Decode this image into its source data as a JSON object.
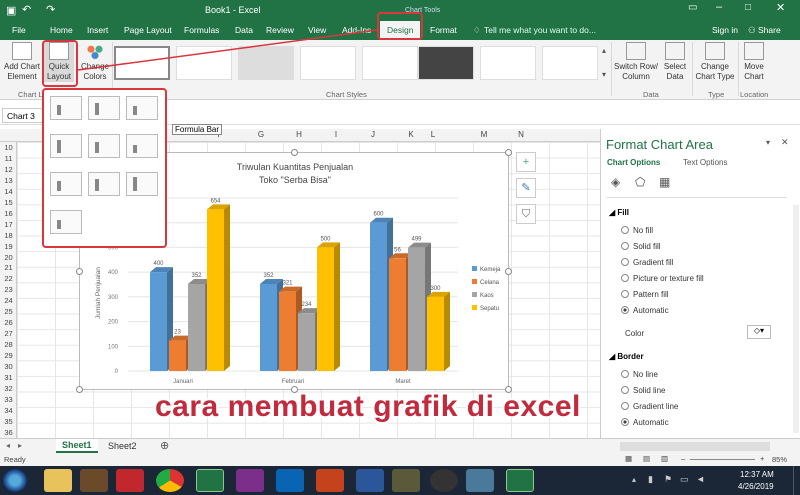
{
  "titlebar": {
    "title": "Book1 - Excel",
    "context": "Chart Tools",
    "signin": "Sign in",
    "share": "Share"
  },
  "tabs": [
    "File",
    "Home",
    "Insert",
    "Page Layout",
    "Formulas",
    "Data",
    "Review",
    "View",
    "Add-Ins",
    "Design",
    "Format"
  ],
  "tellme": "Tell me what you want to do...",
  "ribbon": {
    "add_chart_element": "Add Chart Element",
    "quick_layout": "Quick Layout",
    "change_colors": "Change Colors",
    "switch_row_col": "Switch Row/ Column",
    "select_data": "Select Data",
    "change_chart_type": "Change Chart Type",
    "move_chart": "Move Chart",
    "groups": {
      "layouts": "Chart La",
      "styles": "Chart Styles",
      "data": "Data",
      "type": "Type",
      "location": "Location"
    }
  },
  "namebox": "Chart 3",
  "formula_tooltip": "Formula Bar",
  "columns": [
    "F",
    "G",
    "H",
    "I",
    "J",
    "K",
    "L",
    "M",
    "N"
  ],
  "rows": [
    "10",
    "11",
    "12",
    "13",
    "14",
    "15",
    "16",
    "17",
    "18",
    "19",
    "20",
    "21",
    "22",
    "23",
    "24",
    "25",
    "26",
    "27",
    "28",
    "29",
    "30",
    "31",
    "32",
    "33",
    "34",
    "35",
    "36"
  ],
  "chart_data": {
    "type": "bar",
    "title": "Triwulan Kuantitas Penjualan",
    "subtitle": "Toko \"Serba Bisa\"",
    "ylabel": "Jumlah Penjualan",
    "categories": [
      "Januari",
      "Februari",
      "Maret"
    ],
    "series": [
      {
        "name": "Kemeja",
        "color": "#5b9bd5",
        "values": [
          400,
          352,
          600
        ]
      },
      {
        "name": "Celana",
        "color": "#ed7d31",
        "values": [
          123,
          321,
          456
        ]
      },
      {
        "name": "Kaos",
        "color": "#a5a5a5",
        "values": [
          352,
          234,
          499
        ]
      },
      {
        "name": "Sepatu",
        "color": "#ffc000",
        "values": [
          654,
          500,
          300
        ]
      }
    ],
    "value_labels": [
      [
        "400",
        "23",
        "352",
        "654"
      ],
      [
        "352",
        "321",
        "234",
        "500"
      ],
      [
        "600",
        "56",
        "499",
        "300"
      ]
    ],
    "y_tick_labels": [
      "0",
      "100",
      "200",
      "300",
      "400",
      "500",
      "600",
      "700"
    ],
    "ylim": [
      0,
      700
    ],
    "legend": "right"
  },
  "pane": {
    "title": "Format Chart Area",
    "tab1": "Chart Options",
    "tab2": "Text Options",
    "fill_header": "Fill",
    "fill_options": [
      "No fill",
      "Solid fill",
      "Gradient fill",
      "Picture or texture fill",
      "Pattern fill",
      "Automatic"
    ],
    "color_label": "Color",
    "border_header": "Border",
    "border_options": [
      "No line",
      "Solid line",
      "Gradient line",
      "Automatic"
    ]
  },
  "sheets": [
    "Sheet1",
    "Sheet2"
  ],
  "status": {
    "ready": "Ready",
    "zoom": "85%"
  },
  "clock": {
    "time": "12:37 AM",
    "date": "4/26/2019"
  },
  "caption": "cara membuat grafik di excel"
}
